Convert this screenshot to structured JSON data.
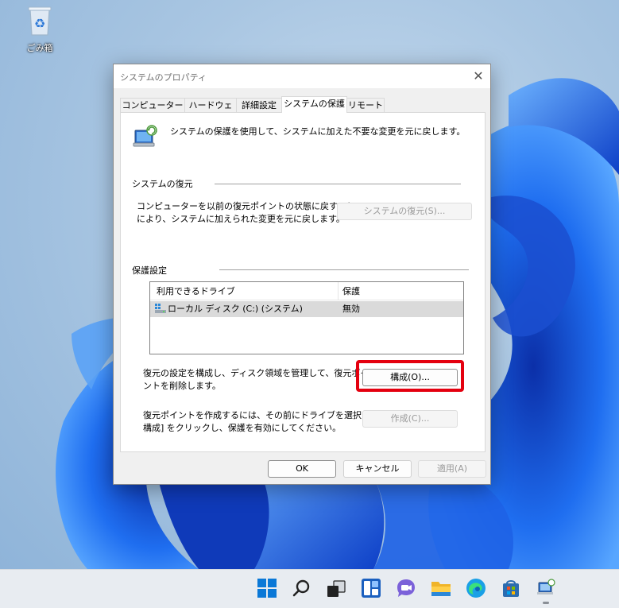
{
  "desktop": {
    "recycle_bin_label": "ごみ箱",
    "recycle_bin_icon": "recycle-bin-icon"
  },
  "dialog": {
    "title": "システムのプロパティ",
    "close_glyph": "✕",
    "tabs": [
      {
        "label": "コンピューター名",
        "active": false
      },
      {
        "label": "ハードウェア",
        "active": false
      },
      {
        "label": "詳細設定",
        "active": false
      },
      {
        "label": "システムの保護",
        "active": true
      },
      {
        "label": "リモート",
        "active": false
      }
    ],
    "intro_text": "システムの保護を使用して、システムに加えた不要な変更を元に戻します。",
    "restore_section": {
      "heading": "システムの復元",
      "desc_line1": "コンピューターを以前の復元ポイントの状態に戻すこと",
      "desc_line2": "により、システムに加えられた変更を元に戻します。",
      "button": "システムの復元(S)..."
    },
    "protection_section": {
      "heading": "保護設定",
      "columns": [
        "利用できるドライブ",
        "保護"
      ],
      "rows": [
        {
          "drive": "ローカル ディスク (C:) (システム)",
          "protection": "無効"
        }
      ]
    },
    "configure": {
      "desc_line1": "復元の設定を構成し、ディスク領域を管理して、復元ポイ",
      "desc_line2": "ントを削除します。",
      "button": "構成(O)..."
    },
    "create": {
      "desc_line1": "復元ポイントを作成するには、その前にドライブを選択して [",
      "desc_line2": "構成] をクリックし、保護を有効にしてください。",
      "button": "作成(C)..."
    },
    "footer": {
      "ok": "OK",
      "cancel": "キャンセル",
      "apply": "適用(A)"
    }
  },
  "taskbar": {
    "icons": [
      "start-icon",
      "search-icon",
      "task-view-icon",
      "widgets-icon",
      "chat-icon",
      "file-explorer-icon",
      "edge-icon",
      "store-icon",
      "system-properties-icon"
    ]
  },
  "colors": {
    "highlight": "#e4000f",
    "win_blue": "#0a5bd6"
  }
}
